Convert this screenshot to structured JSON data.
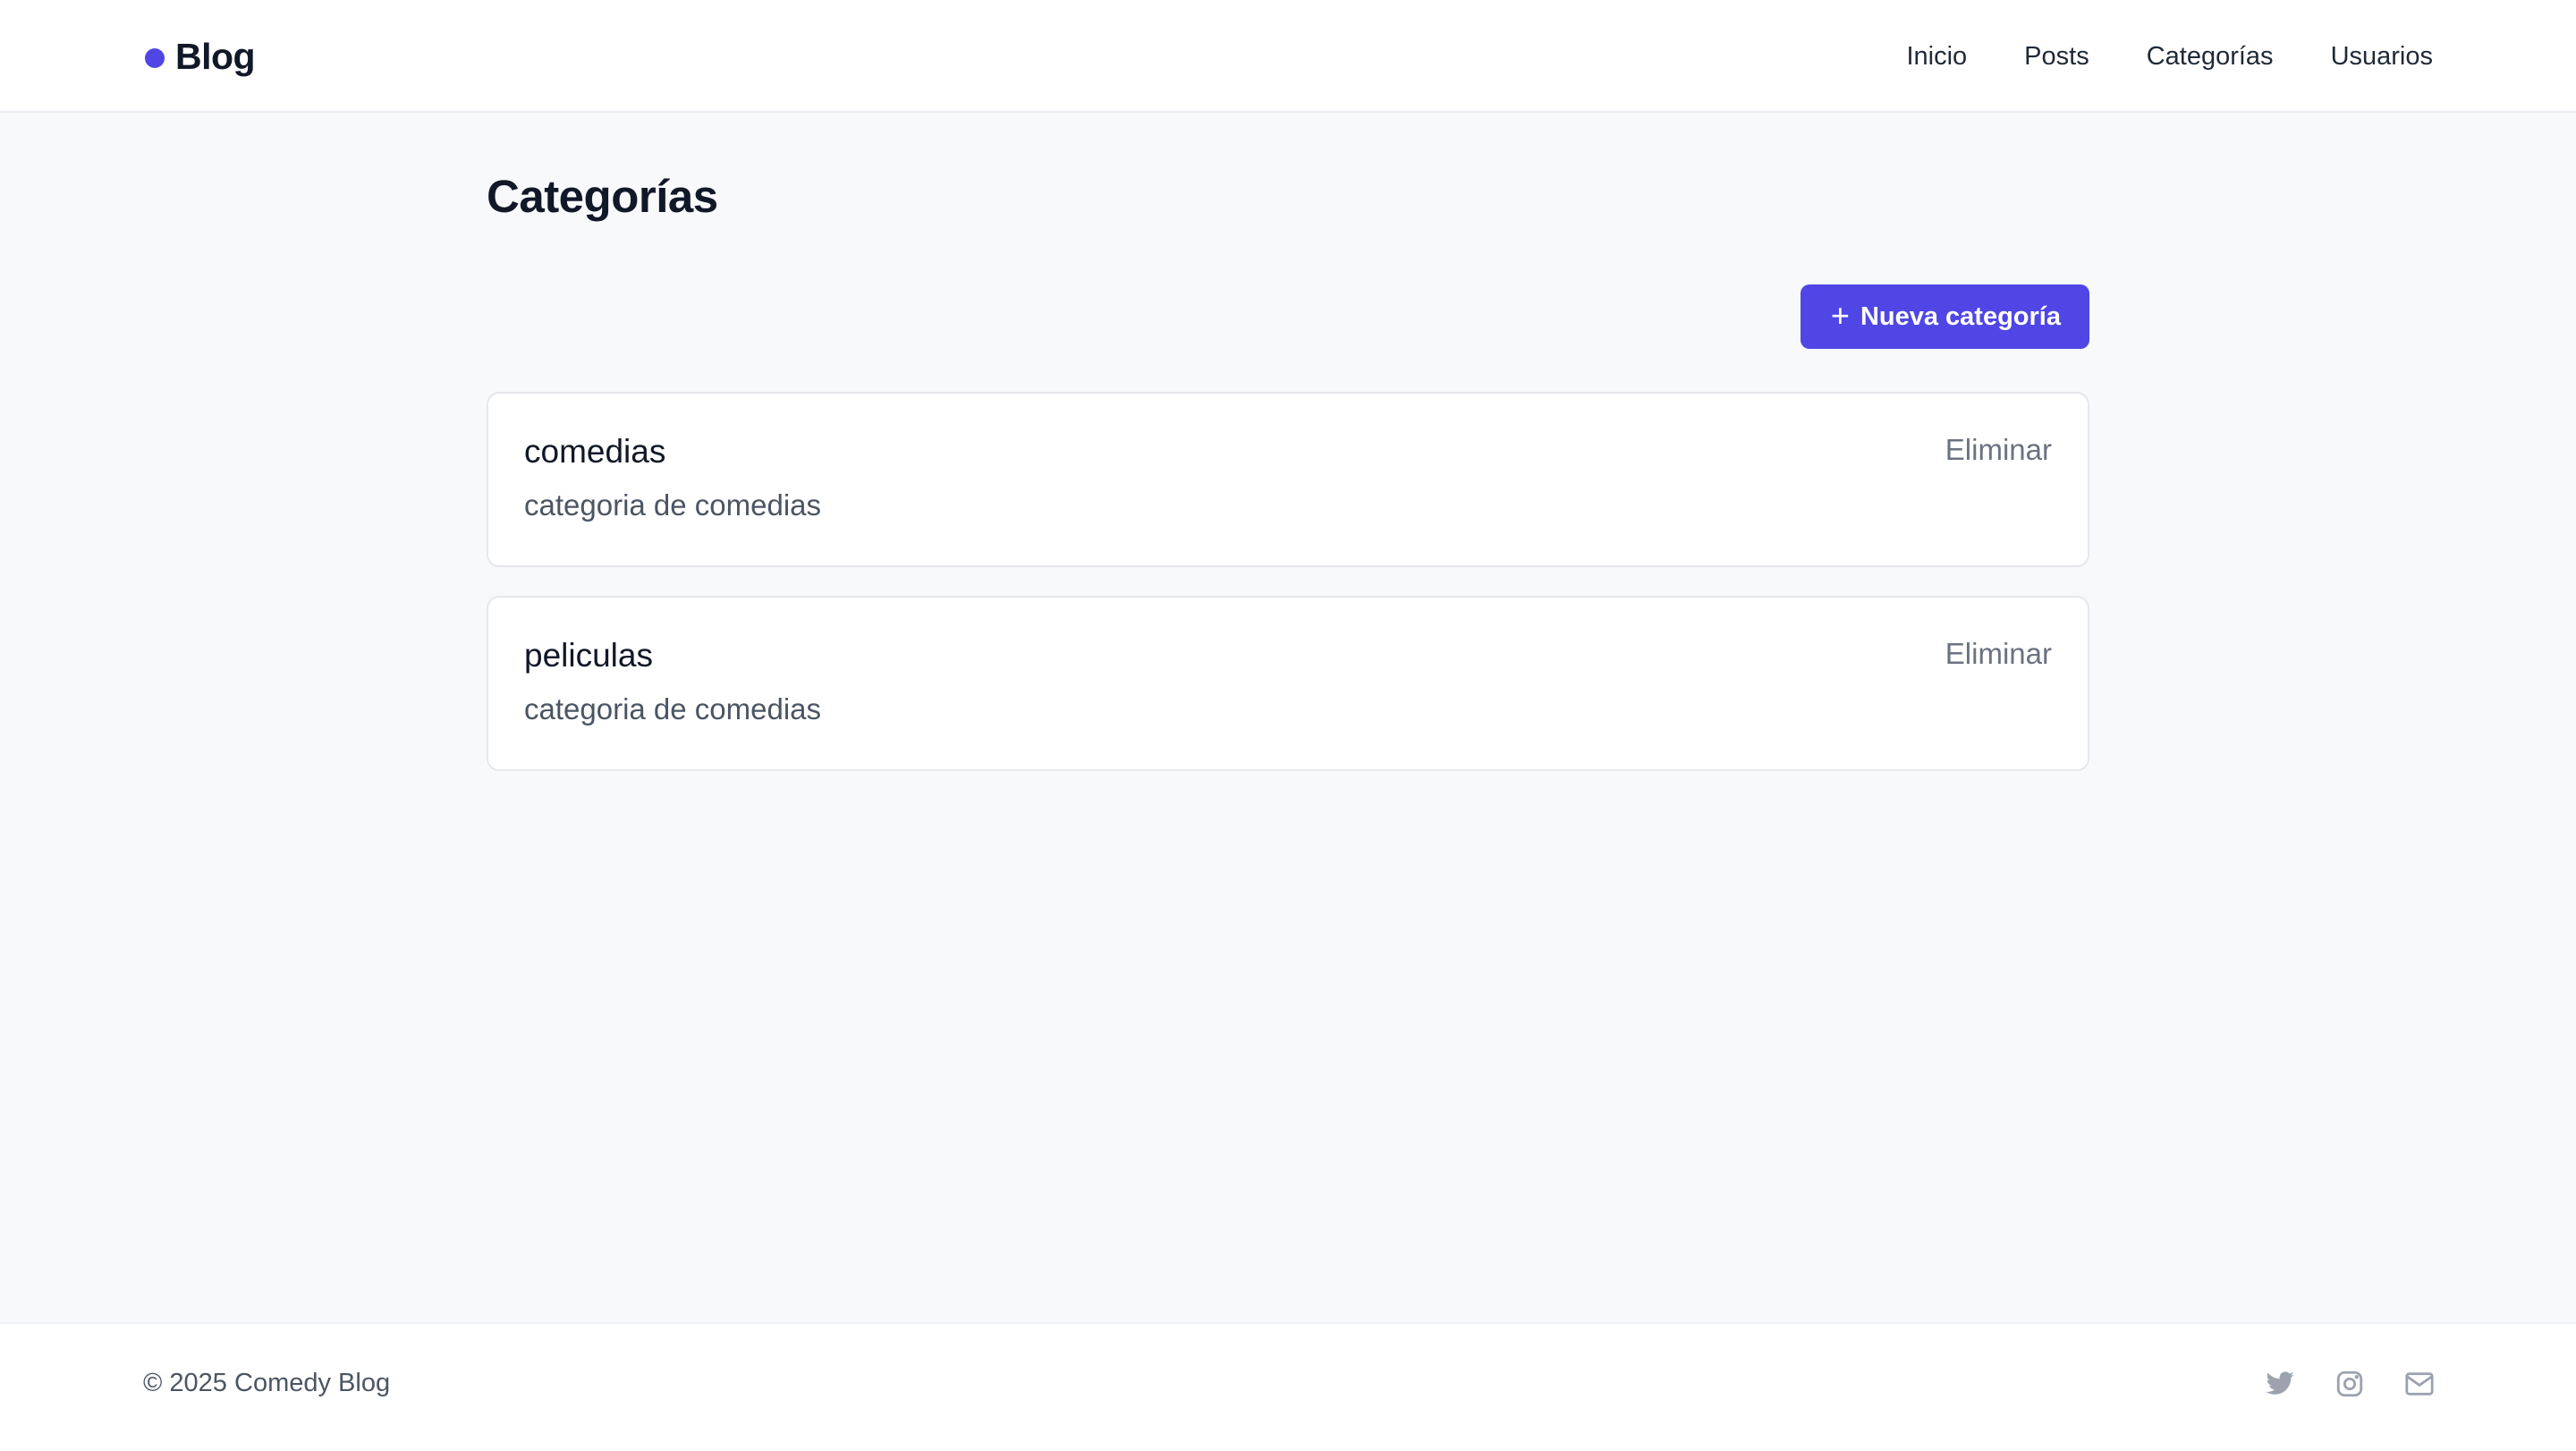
{
  "header": {
    "brand": "Blog",
    "brand_color": "#4f46e5",
    "nav": [
      {
        "label": "Inicio"
      },
      {
        "label": "Posts"
      },
      {
        "label": "Categorías"
      },
      {
        "label": "Usuarios"
      }
    ]
  },
  "main": {
    "title": "Categorías",
    "new_button": {
      "icon": "plus-icon",
      "label": "Nueva categoría"
    },
    "categories": [
      {
        "name": "comedias",
        "description": "categoria de comedias",
        "delete_label": "Eliminar"
      },
      {
        "name": "peliculas",
        "description": "categoria de comedias",
        "delete_label": "Eliminar"
      }
    ]
  },
  "footer": {
    "copyright": "© 2025 Comedy Blog",
    "social": [
      "twitter-icon",
      "instagram-icon",
      "mail-icon"
    ]
  },
  "colors": {
    "accent": "#4f46e5",
    "background": "#f8f9fb",
    "icon_gray": "#9ca3af"
  }
}
